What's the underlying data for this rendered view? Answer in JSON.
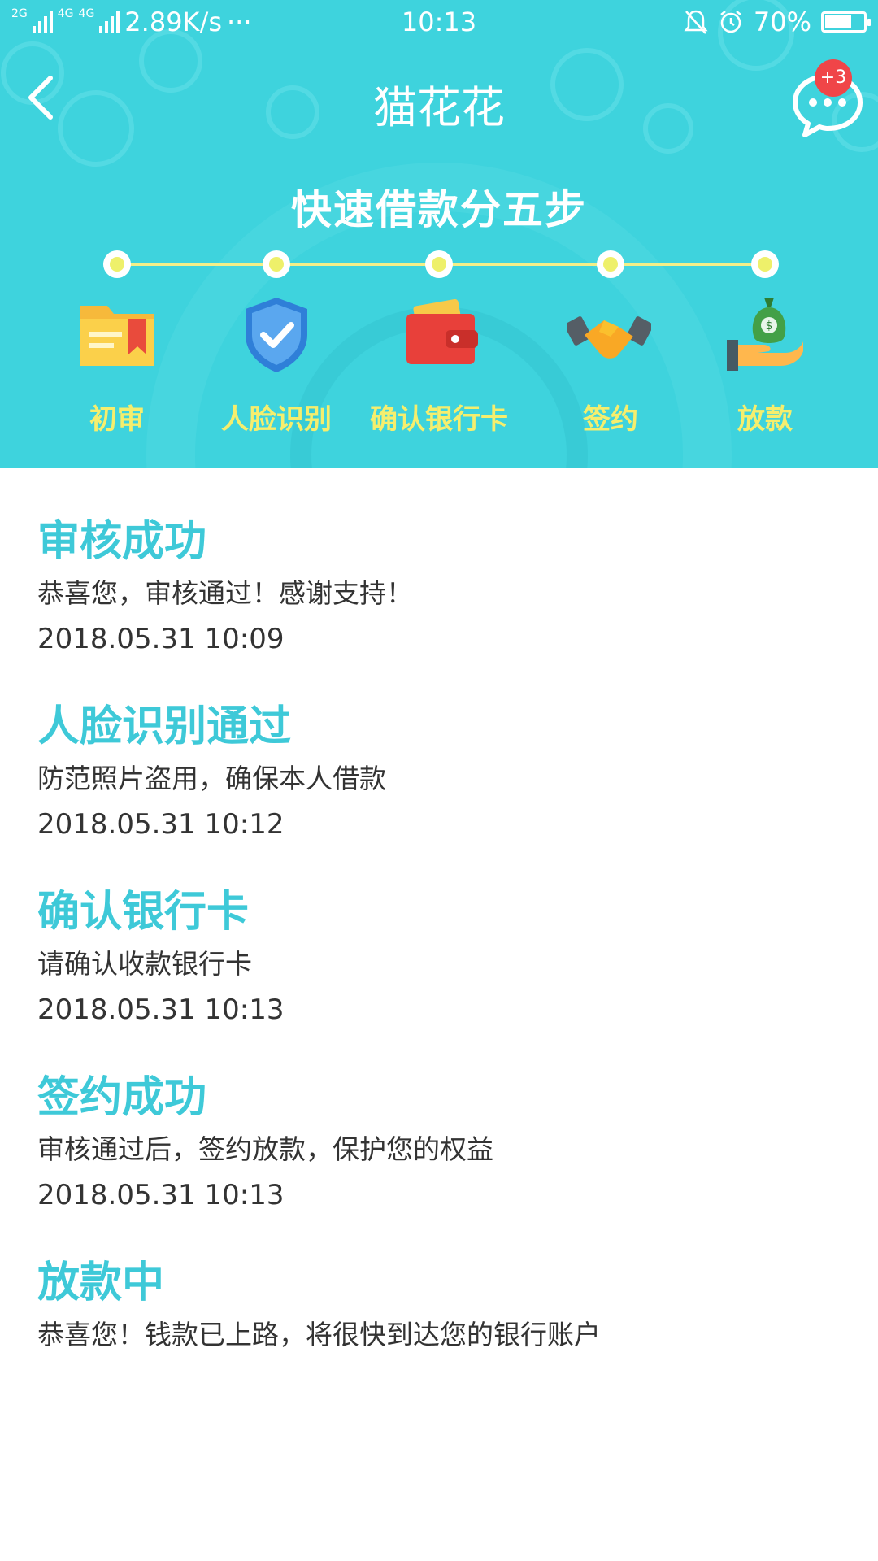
{
  "status_bar": {
    "net1": "2G",
    "net2": "4G",
    "net3": "4G",
    "speed": "2.89K/s",
    "more": "···",
    "time": "10:13",
    "battery_text": "70%",
    "battery_level": 0.7
  },
  "nav": {
    "title": "猫花花",
    "badge": "+3"
  },
  "steps": {
    "heading": "快速借款分五步",
    "items": [
      {
        "label": "初审",
        "icon": "folder-icon"
      },
      {
        "label": "人脸识别",
        "icon": "shield-check-icon"
      },
      {
        "label": "确认银行卡",
        "icon": "wallet-icon"
      },
      {
        "label": "签约",
        "icon": "handshake-icon"
      },
      {
        "label": "放款",
        "icon": "money-bag-hand-icon"
      }
    ]
  },
  "timeline": [
    {
      "title": "审核成功",
      "desc": "恭喜您，审核通过！感谢支持！",
      "time": "2018.05.31  10:09"
    },
    {
      "title": "人脸识别通过",
      "desc": "防范照片盗用，确保本人借款",
      "time": "2018.05.31  10:12"
    },
    {
      "title": "确认银行卡",
      "desc": "请确认收款银行卡",
      "time": "2018.05.31  10:13"
    },
    {
      "title": "签约成功",
      "desc": "审核通过后，签约放款，保护您的权益",
      "time": "2018.05.31  10:13"
    },
    {
      "title": "放款中",
      "desc": "恭喜您！钱款已上路，将很快到达您的银行账户"
    }
  ],
  "colors": {
    "header_bg": "#3ed3dd",
    "title_accent": "#3ec9d8",
    "step_label": "#f5ee6d",
    "badge": "#f04548"
  }
}
